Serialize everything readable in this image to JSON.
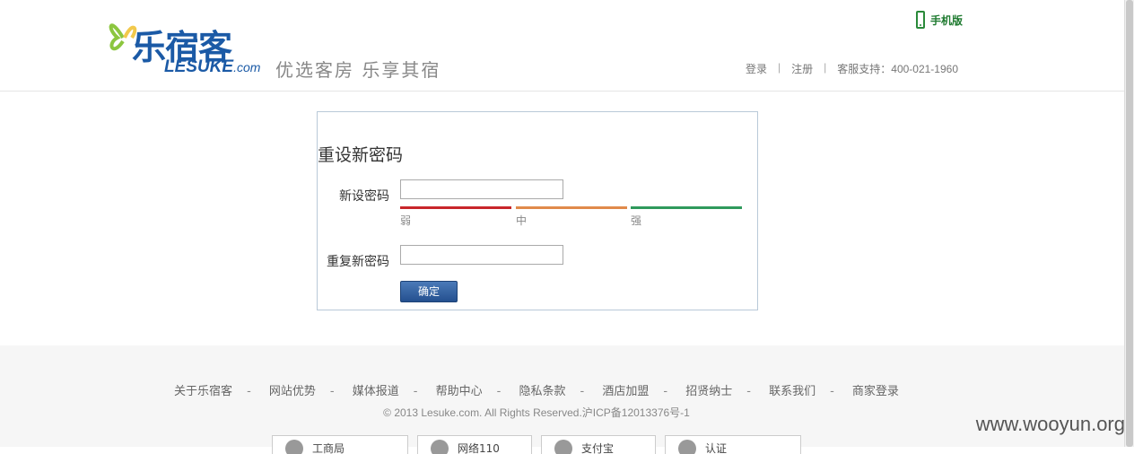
{
  "header": {
    "logo_cn": "乐宿客",
    "logo_en": "LESUKE",
    "logo_en_suffix": ".com",
    "slogan": "优选客房  乐享其宿",
    "mobile_label": "手机版",
    "links": {
      "login": "登录",
      "register": "注册",
      "support": "客服支持：400-021-1960"
    }
  },
  "form": {
    "title": "重设新密码",
    "new_password_label": "新设密码",
    "new_password_value": "",
    "repeat_password_label": "重复新密码",
    "repeat_password_value": "",
    "strength": {
      "weak": "弱",
      "medium": "中",
      "strong": "强"
    },
    "submit_label": "确定"
  },
  "footer": {
    "links": [
      "关于乐宿客",
      "网站优势",
      "媒体报道",
      "帮助中心",
      "隐私条款",
      "酒店加盟",
      "招贤纳士",
      "联系我们",
      "商家登录"
    ],
    "separator": "-",
    "copyright": "© 2013 Lesuke.com. All Rights Reserved.沪ICP备12013376号-1",
    "badges": [
      "工商局",
      "网络110",
      "支付宝",
      "认证"
    ]
  },
  "watermark": "www.wooyun.org",
  "colors": {
    "brand_blue": "#1b5aa6",
    "weak": "#c8262b",
    "medium": "#e08a4b",
    "strong": "#2f9a5c",
    "mobile_green": "#1e7a2f"
  }
}
